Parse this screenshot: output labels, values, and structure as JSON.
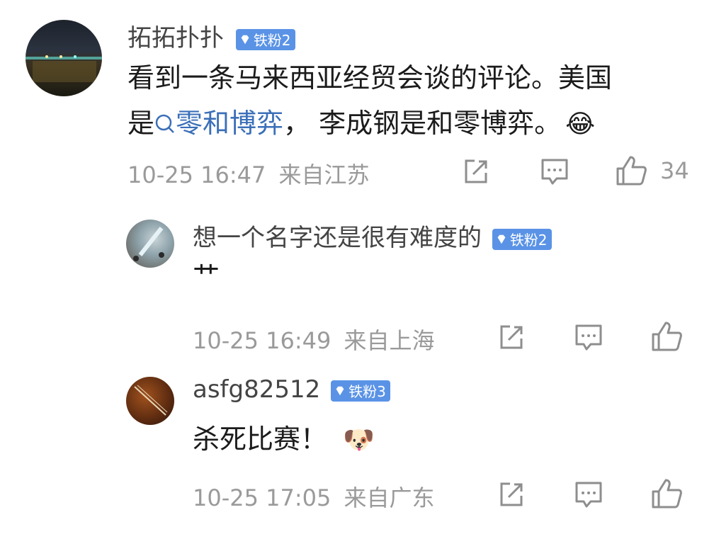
{
  "comments": [
    {
      "username": "拓拓扑扑",
      "badge": "铁粉2",
      "text_line1": "看到一条马来西亚经贸会谈的评论。美国",
      "text_line2_pre": "是",
      "link_text": "零和博弈",
      "text_line2_post": "，  李成钢是和零博弈。",
      "emoji": "😂",
      "time": "10-25 16:47",
      "location": "来自江苏",
      "likes": "34"
    },
    {
      "username": "想一个名字还是很有难度的",
      "badge": "铁粉2",
      "text": "艹",
      "time": "10-25 16:49",
      "location": "来自上海"
    },
    {
      "username": "asfg82512",
      "badge": "铁粉3",
      "text": "杀死比赛！",
      "emoji": "🐶",
      "time": "10-25 17:05",
      "location": "来自广东"
    }
  ],
  "colors": {
    "badge_bg": "#5a93e6",
    "link": "#3b6fb8",
    "meta": "#9a9a9a"
  },
  "icons": [
    "share-icon",
    "reply-icon",
    "like-icon",
    "search-link-icon"
  ]
}
